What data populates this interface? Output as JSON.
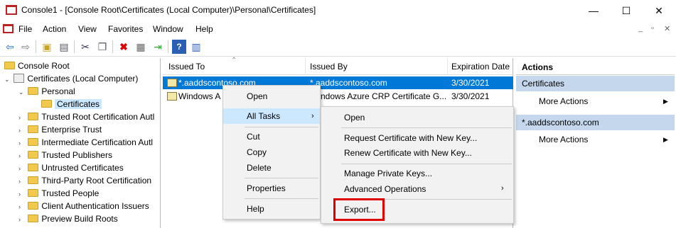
{
  "window": {
    "title": "Console1 - [Console Root\\Certificates (Local Computer)\\Personal\\Certificates]",
    "min": "—",
    "max": "☐",
    "close": "✕"
  },
  "menu": [
    "File",
    "Action",
    "View",
    "Favorites",
    "Window",
    "Help"
  ],
  "mdi": {
    "min": "_",
    "restore": "▫",
    "close": "✕"
  },
  "tree": {
    "root": "Console Root",
    "certs": "Certificates (Local Computer)",
    "personal": "Personal",
    "certificates": "Certificates",
    "items": [
      "Trusted Root Certification Autl",
      "Enterprise Trust",
      "Intermediate Certification Autl",
      "Trusted Publishers",
      "Untrusted Certificates",
      "Third-Party Root Certification",
      "Trusted People",
      "Client Authentication Issuers",
      "Preview Build Roots"
    ]
  },
  "list": {
    "headers": [
      "Issued To",
      "Issued By",
      "Expiration Date"
    ],
    "rows": [
      {
        "issued_to": "*.aaddscontoso.com",
        "issued_by": "*.aaddscontoso.com",
        "expires": "3/30/2021"
      },
      {
        "issued_to": "Windows A",
        "issued_by": "ndows Azure CRP Certificate G...",
        "expires": "3/30/2021"
      }
    ]
  },
  "actions": {
    "title": "Actions",
    "sections": [
      {
        "header": "Certificates",
        "item": "More Actions"
      },
      {
        "header": "*.aaddscontoso.com",
        "item": "More Actions"
      }
    ]
  },
  "context_menu": [
    "Open",
    "All Tasks",
    "Cut",
    "Copy",
    "Delete",
    "Properties",
    "Help"
  ],
  "submenu": [
    "Open",
    "Request Certificate with New Key...",
    "Renew Certificate with New Key...",
    "Manage Private Keys...",
    "Advanced Operations",
    "Export..."
  ],
  "colors": {
    "selection": "#0078d7",
    "highlight": "#e00000",
    "section": "#c4d7ec"
  }
}
